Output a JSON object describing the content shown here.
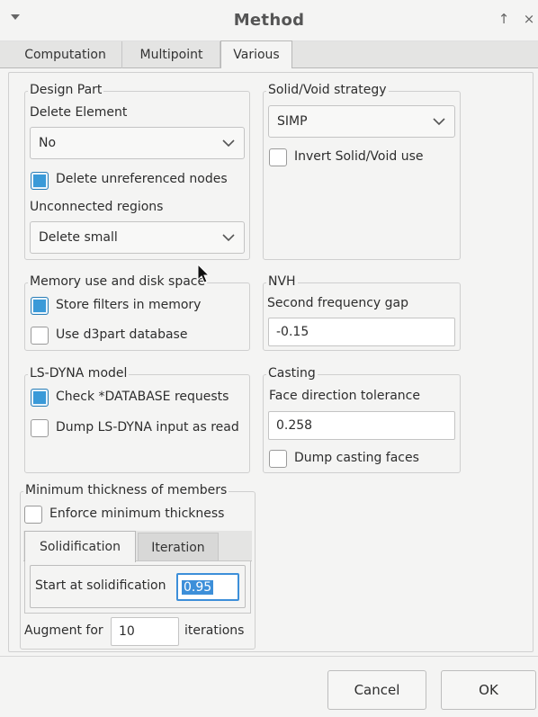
{
  "window": {
    "title": "Method",
    "pin_glyph": "↑",
    "close_glyph": "×"
  },
  "tabs": [
    {
      "label": "Computation"
    },
    {
      "label": "Multipoint"
    },
    {
      "label": "Various"
    }
  ],
  "design_part": {
    "group_label": "Design Part",
    "delete_element_label": "Delete Element",
    "delete_element_value": "No",
    "delete_unreferenced_label": "Delete unreferenced nodes",
    "delete_unreferenced_checked": true,
    "unconnected_label": "Unconnected regions",
    "unconnected_value": "Delete small"
  },
  "solid_void": {
    "group_label": "Solid/Void strategy",
    "strategy_value": "SIMP",
    "invert_label": "Invert Solid/Void use",
    "invert_checked": false
  },
  "memory": {
    "group_label": "Memory use and disk space",
    "store_filters_label": "Store filters in memory",
    "store_filters_checked": true,
    "d3part_label": "Use d3part database",
    "d3part_checked": false
  },
  "nvh": {
    "group_label": "NVH",
    "gap_label": "Second frequency gap",
    "gap_value": "-0.15"
  },
  "lsdyna": {
    "group_label": "LS-DYNA model",
    "check_db_label": "Check *DATABASE requests",
    "check_db_checked": true,
    "dump_label": "Dump LS-DYNA input as read",
    "dump_checked": false
  },
  "casting": {
    "group_label": "Casting",
    "tolerance_label": "Face direction tolerance",
    "tolerance_value": "0.258",
    "dump_faces_label": "Dump casting faces",
    "dump_faces_checked": false
  },
  "min_thickness": {
    "group_label": "Minimum thickness of members",
    "enforce_label": "Enforce minimum thickness",
    "enforce_checked": false,
    "subtabs": [
      {
        "label": "Solidification"
      },
      {
        "label": "Iteration"
      }
    ],
    "start_label": "Start at solidification",
    "start_value": "0.95",
    "augment_label": "Augment for",
    "augment_value": "10",
    "iterations_label": "iterations"
  },
  "buttons": {
    "cancel": "Cancel",
    "ok": "OK"
  },
  "colors": {
    "accent": "#3a9ad8",
    "background": "#f4f4f3",
    "selection": "#3d8fd9"
  }
}
